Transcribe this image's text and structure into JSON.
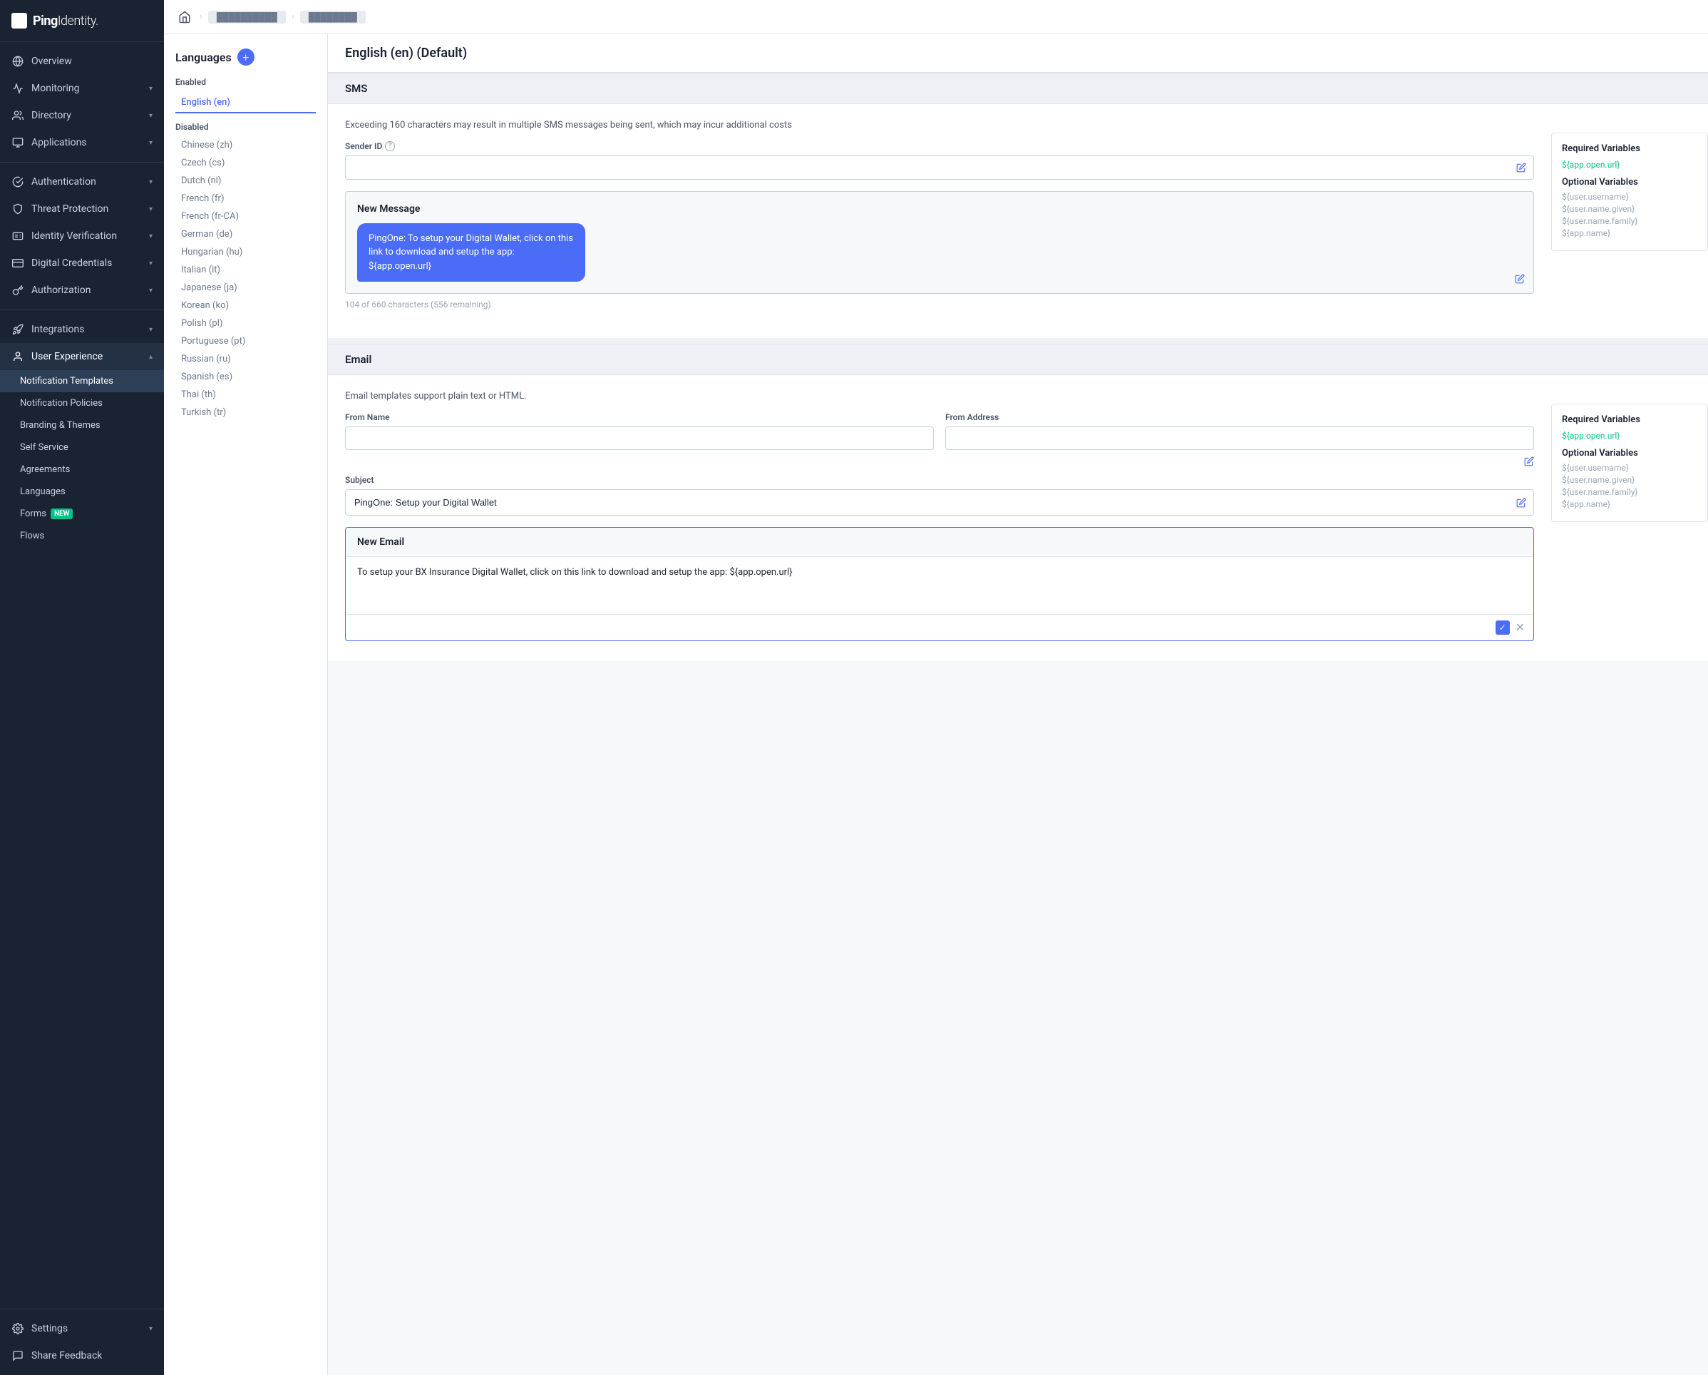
{
  "sidebar": {
    "logo_text": "Ping",
    "logo_text2": "Identity.",
    "nav_items": [
      {
        "id": "overview",
        "label": "Overview",
        "icon": "globe",
        "hasArrow": false
      },
      {
        "id": "monitoring",
        "label": "Monitoring",
        "icon": "activity",
        "hasArrow": true
      },
      {
        "id": "directory",
        "label": "Directory",
        "icon": "users",
        "hasArrow": true
      },
      {
        "id": "applications",
        "label": "Applications",
        "icon": "terminal",
        "hasArrow": true
      },
      {
        "id": "authentication",
        "label": "Authentication",
        "icon": "check-circle",
        "hasArrow": true
      },
      {
        "id": "threat-protection",
        "label": "Threat Protection",
        "icon": "shield",
        "hasArrow": true
      },
      {
        "id": "identity-verification",
        "label": "Identity Verification",
        "icon": "id-card",
        "hasArrow": true
      },
      {
        "id": "digital-credentials",
        "label": "Digital Credentials",
        "icon": "credit-card",
        "hasArrow": true
      },
      {
        "id": "authorization",
        "label": "Authorization",
        "icon": "key",
        "hasArrow": true
      },
      {
        "id": "integrations",
        "label": "Integrations",
        "icon": "rocket",
        "hasArrow": true
      },
      {
        "id": "user-experience",
        "label": "User Experience",
        "icon": "user",
        "hasArrow": true,
        "active": true
      }
    ],
    "sub_items": [
      {
        "id": "notification-templates",
        "label": "Notification Templates",
        "active": true
      },
      {
        "id": "notification-policies",
        "label": "Notification Policies"
      },
      {
        "id": "branding-themes",
        "label": "Branding & Themes"
      },
      {
        "id": "self-service",
        "label": "Self Service"
      },
      {
        "id": "agreements",
        "label": "Agreements"
      },
      {
        "id": "languages",
        "label": "Languages"
      },
      {
        "id": "forms",
        "label": "Forms",
        "badge": "NEW"
      },
      {
        "id": "flows",
        "label": "Flows"
      }
    ],
    "footer_items": [
      {
        "id": "settings",
        "label": "Settings",
        "hasArrow": true
      },
      {
        "id": "share-feedback",
        "label": "Share Feedback"
      }
    ]
  },
  "topbar": {
    "home_icon": "home",
    "breadcrumb": [
      "blurred-env",
      "blurred-item"
    ]
  },
  "languages_panel": {
    "title": "Languages",
    "add_btn_title": "+",
    "enabled_section": "Enabled",
    "enabled_languages": [
      {
        "code": "en",
        "label": "English (en)",
        "active": true
      }
    ],
    "disabled_section": "Disabled",
    "disabled_languages": [
      {
        "code": "zh",
        "label": "Chinese (zh)"
      },
      {
        "code": "cs",
        "label": "Czech (cs)"
      },
      {
        "code": "nl",
        "label": "Dutch (nl)"
      },
      {
        "code": "fr",
        "label": "French (fr)"
      },
      {
        "code": "fr-CA",
        "label": "French (fr-CA)"
      },
      {
        "code": "de",
        "label": "German (de)"
      },
      {
        "code": "hu",
        "label": "Hungarian (hu)"
      },
      {
        "code": "it",
        "label": "Italian (it)"
      },
      {
        "code": "ja",
        "label": "Japanese (ja)"
      },
      {
        "code": "ko",
        "label": "Korean (ko)"
      },
      {
        "code": "pl",
        "label": "Polish (pl)"
      },
      {
        "code": "pt",
        "label": "Portuguese (pt)"
      },
      {
        "code": "ru",
        "label": "Russian (ru)"
      },
      {
        "code": "es",
        "label": "Spanish (es)"
      },
      {
        "code": "th",
        "label": "Thai (th)"
      },
      {
        "code": "tr",
        "label": "Turkish (tr)"
      }
    ]
  },
  "template": {
    "title": "English (en) (Default)",
    "sms": {
      "section_label": "SMS",
      "description": "Exceeding 160 characters may result in multiple SMS messages being sent, which may incur additional costs",
      "sender_id_label": "Sender ID",
      "sender_id_help": "?",
      "sender_id_value": "",
      "new_message_title": "New Message",
      "message_text": "PingOne: To setup your Digital Wallet, click on this link to download and setup the app: ${app.open.url}",
      "char_count": "104 of 660 characters (556 remaining)",
      "required_vars_title": "Required Variables",
      "required_vars": [
        "${app.open.url}"
      ],
      "optional_vars_title": "Optional Variables",
      "optional_vars": [
        "${user.username}",
        "${user.name.given}",
        "${user.name.family}",
        "${app.name}"
      ]
    },
    "email": {
      "section_label": "Email",
      "description": "Email templates support plain text or HTML.",
      "from_name_label": "From Name",
      "from_name_value": "",
      "from_address_label": "From Address",
      "from_address_value": "",
      "subject_label": "Subject",
      "subject_value": "PingOne: Setup your Digital Wallet",
      "new_email_title": "New Email",
      "email_body": "To setup your BX Insurance Digital Wallet, click on this link to download and setup the app: ${app.open.url}",
      "required_vars_title": "Required Variables",
      "required_vars": [
        "${app.open.url}"
      ],
      "optional_vars_title": "Optional Variables",
      "optional_vars": [
        "${user.username}",
        "${user.name.given}",
        "${user.name.family}",
        "${app.name}"
      ]
    }
  }
}
